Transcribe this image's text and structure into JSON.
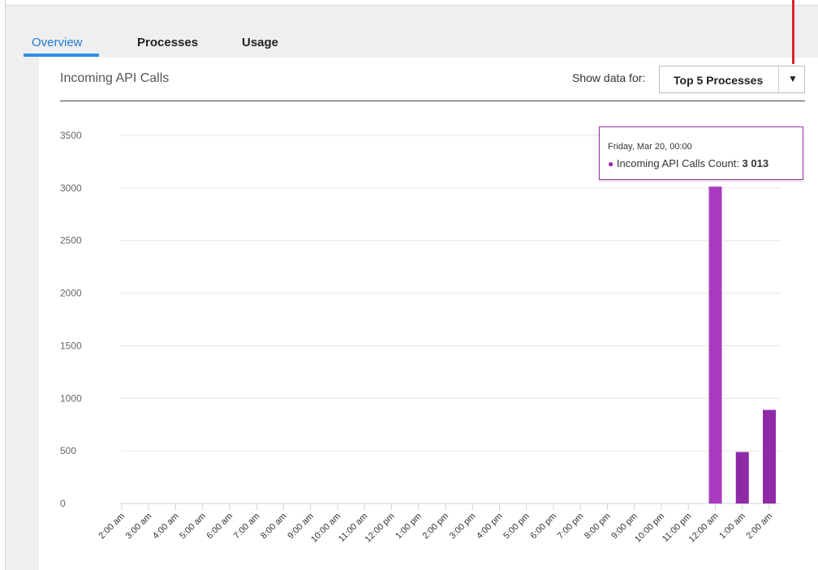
{
  "tabs": [
    {
      "label": "Overview",
      "active": true
    },
    {
      "label": "Processes",
      "active": false
    },
    {
      "label": "Usage",
      "active": false
    }
  ],
  "panel": {
    "title": "Incoming API Calls",
    "show_data_label": "Show data for:",
    "show_data_value": "Top 5 Processes"
  },
  "tooltip": {
    "date": "Friday, Mar 20, 00:00",
    "series_label": "Incoming API Calls Count: ",
    "value_text": "3 013"
  },
  "colors": {
    "bar": "#a93bbe",
    "bar_dark": "#8e2aa6",
    "accent": "#2f8fe6",
    "marker": "#e0222c"
  },
  "chart_data": {
    "type": "bar",
    "categories": [
      "2:00 am",
      "3:00 am",
      "4:00 am",
      "5:00 am",
      "6:00 am",
      "7:00 am",
      "8:00 am",
      "9:00 am",
      "10:00 am",
      "11:00 am",
      "12:00 pm",
      "1:00 pm",
      "2:00 pm",
      "3:00 pm",
      "4:00 pm",
      "5:00 pm",
      "6:00 pm",
      "7:00 pm",
      "8:00 pm",
      "9:00 pm",
      "10:00 pm",
      "11:00 pm",
      "12:00 am",
      "1:00 am",
      "2:00 am"
    ],
    "values": [
      0,
      0,
      0,
      0,
      0,
      0,
      0,
      0,
      0,
      0,
      0,
      0,
      0,
      0,
      0,
      0,
      0,
      0,
      0,
      0,
      0,
      0,
      3013,
      490,
      890
    ],
    "ylim": [
      0,
      3500
    ],
    "yticks": [
      0,
      500,
      1000,
      1500,
      2000,
      2500,
      3000,
      3500
    ],
    "grid": true
  }
}
